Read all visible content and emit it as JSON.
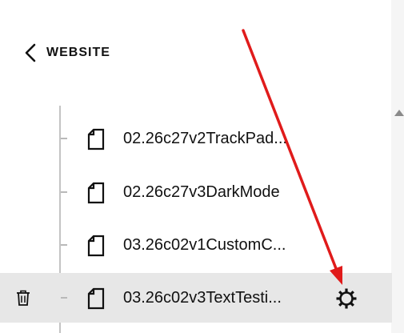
{
  "nav": {
    "back_label": "WEBSITE"
  },
  "pages": [
    {
      "label": "02.26c27v2TrackPad...",
      "icon": "page-icon",
      "selected": false
    },
    {
      "label": "02.26c27v3DarkMode",
      "icon": "page-icon",
      "selected": false
    },
    {
      "label": "03.26c02v1CustomC...",
      "icon": "page-icon",
      "selected": false
    },
    {
      "label": "03.26c02v3TextTesti...",
      "icon": "page-icon",
      "selected": true
    }
  ],
  "selected_row_actions": {
    "left": "trash-icon",
    "right": "gear-icon"
  },
  "colors": {
    "selected_row_bg": "#e7e7e7",
    "annotation_arrow": "#e01b1b",
    "tree_line": "#c4c4c4"
  }
}
